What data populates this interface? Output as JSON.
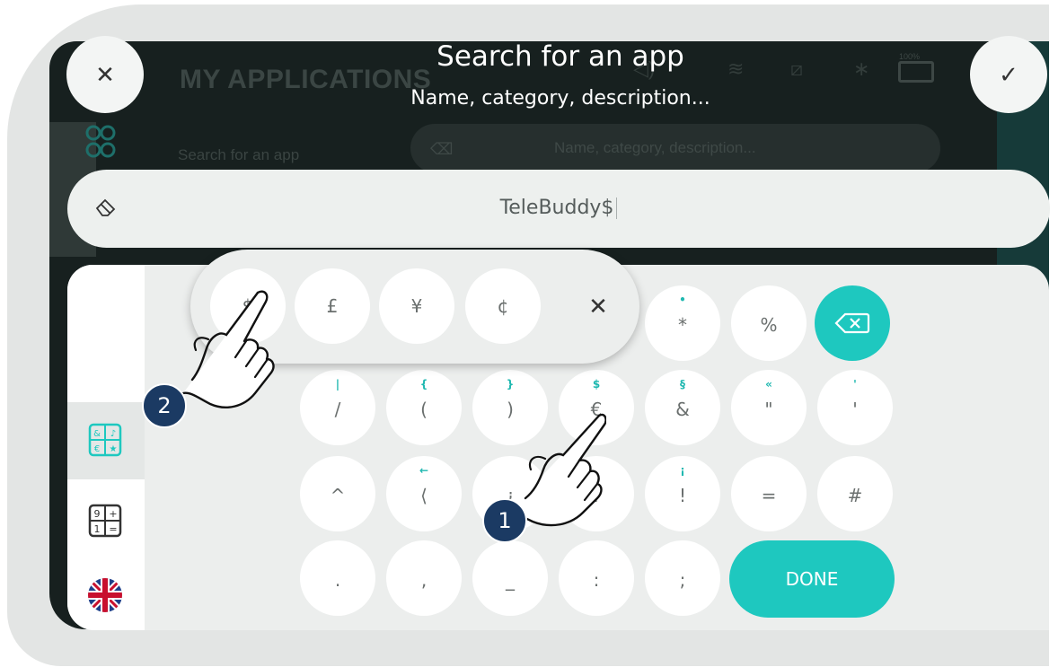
{
  "background": {
    "app_title": "MY APPLICATIONS",
    "search_label": "Search for an app",
    "search_placeholder": "Name, category, description...",
    "battery_percent": "100%"
  },
  "dialog": {
    "title": "Search for an app",
    "subtitle": "Name, category, description..."
  },
  "input": {
    "value": "TeleBuddy$"
  },
  "currency_popup": {
    "keys": [
      "$",
      "£",
      "¥",
      "¢"
    ]
  },
  "keyboard": {
    "rows": [
      [
        {
          "alt": "•",
          "main": "*"
        },
        {
          "alt": "",
          "main": "%"
        }
      ],
      [
        {
          "alt": "|",
          "main": "/"
        },
        {
          "alt": "{",
          "main": "("
        },
        {
          "alt": "}",
          "main": ")"
        },
        {
          "alt": "$",
          "main": "€"
        },
        {
          "alt": "§",
          "main": "&"
        },
        {
          "alt": "«",
          "main": "\""
        },
        {
          "alt": "'",
          "main": "'"
        }
      ],
      [
        {
          "alt": "",
          "main": "^"
        },
        {
          "alt": "←",
          "main": "⟨"
        },
        {
          "alt": "",
          "main": "¿"
        },
        {
          "alt": "",
          "main": "?"
        },
        {
          "alt": "¡",
          "main": "!"
        },
        {
          "alt": "",
          "main": "="
        },
        {
          "alt": "",
          "main": "#"
        }
      ],
      [
        {
          "alt": "",
          "main": "."
        },
        {
          "alt": "",
          "main": ","
        },
        {
          "alt": "",
          "main": "_"
        },
        {
          "alt": "",
          "main": ":"
        },
        {
          "alt": "",
          "main": ";"
        }
      ]
    ],
    "done_label": "DONE"
  },
  "badges": {
    "step1": "1",
    "step2": "2"
  },
  "colors": {
    "accent": "#1ec8bf",
    "badge": "#1b3a63"
  }
}
